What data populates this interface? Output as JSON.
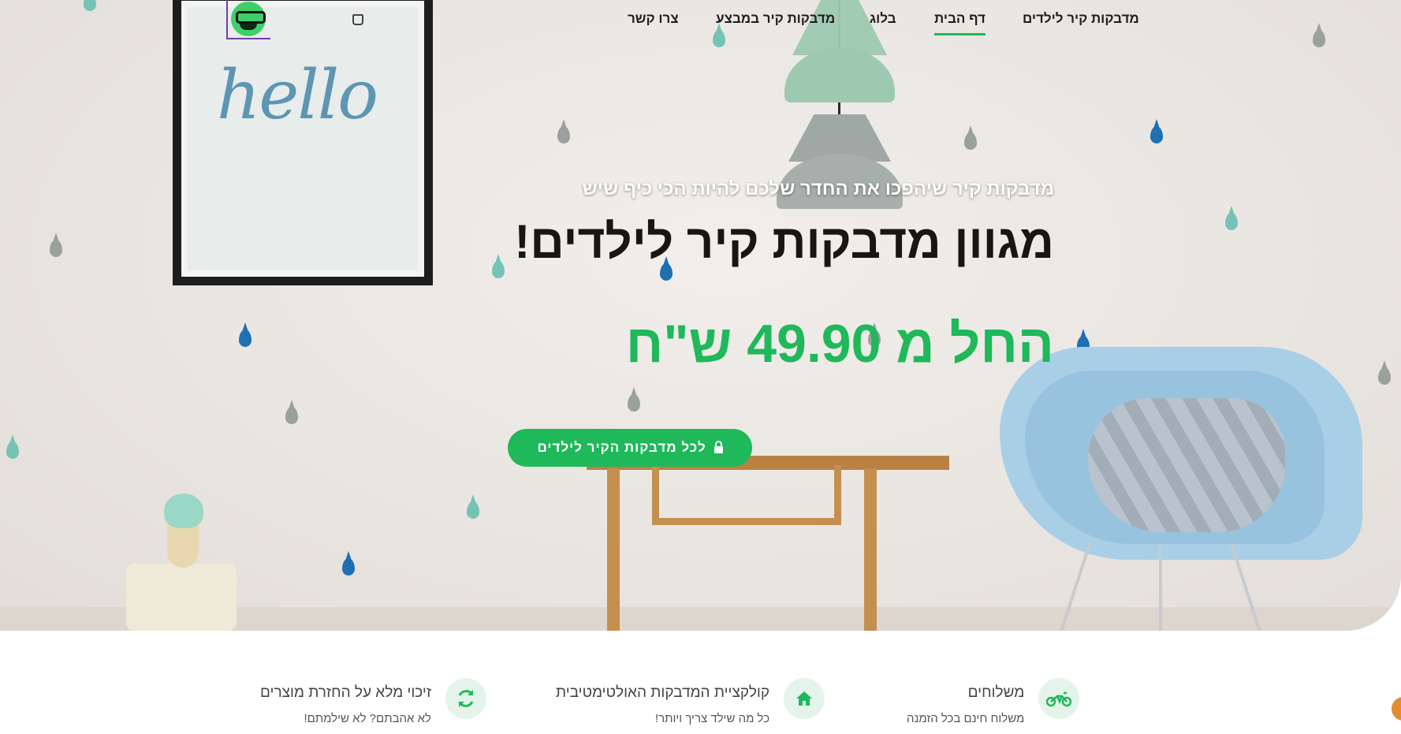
{
  "nav": {
    "items": [
      {
        "label": "מדבקות קיר לילדים",
        "active": false
      },
      {
        "label": "דף הבית",
        "active": true
      },
      {
        "label": "בלוג",
        "active": false
      },
      {
        "label": "מדבקות קיר במבצע",
        "active": false
      },
      {
        "label": "צרו קשר",
        "active": false
      }
    ],
    "logo_icon": "monkey-logo-icon",
    "cart_icon": "shopping-bag-icon"
  },
  "hero": {
    "tagline": "מדבקות קיר שיהפכו את החדר שלכם להיות הכי כיף שיש",
    "headline": "מגוון מדבקות קיר לילדים!",
    "price": "החל מ 49.90 ש\"ח",
    "cta_label": "לכל מדבקות הקיר לילדים",
    "cta_icon": "lock-icon",
    "decor_text": "hello"
  },
  "features": [
    {
      "title": "משלוחים",
      "subtitle": "משלוח חינם בכל הזמנה",
      "icon": "motorcycle-icon"
    },
    {
      "title": "קולקציית המדבקות האולטימטיבית",
      "subtitle": "כל מה שילד צריך ויותר!",
      "icon": "home-icon"
    },
    {
      "title": "זיכוי מלא על החזרת מוצרים",
      "subtitle": "לא אהבתם? לא שילמתם!",
      "icon": "refresh-icon"
    }
  ],
  "colors": {
    "accent": "#1fb85a",
    "chat": "#e38b2f"
  }
}
